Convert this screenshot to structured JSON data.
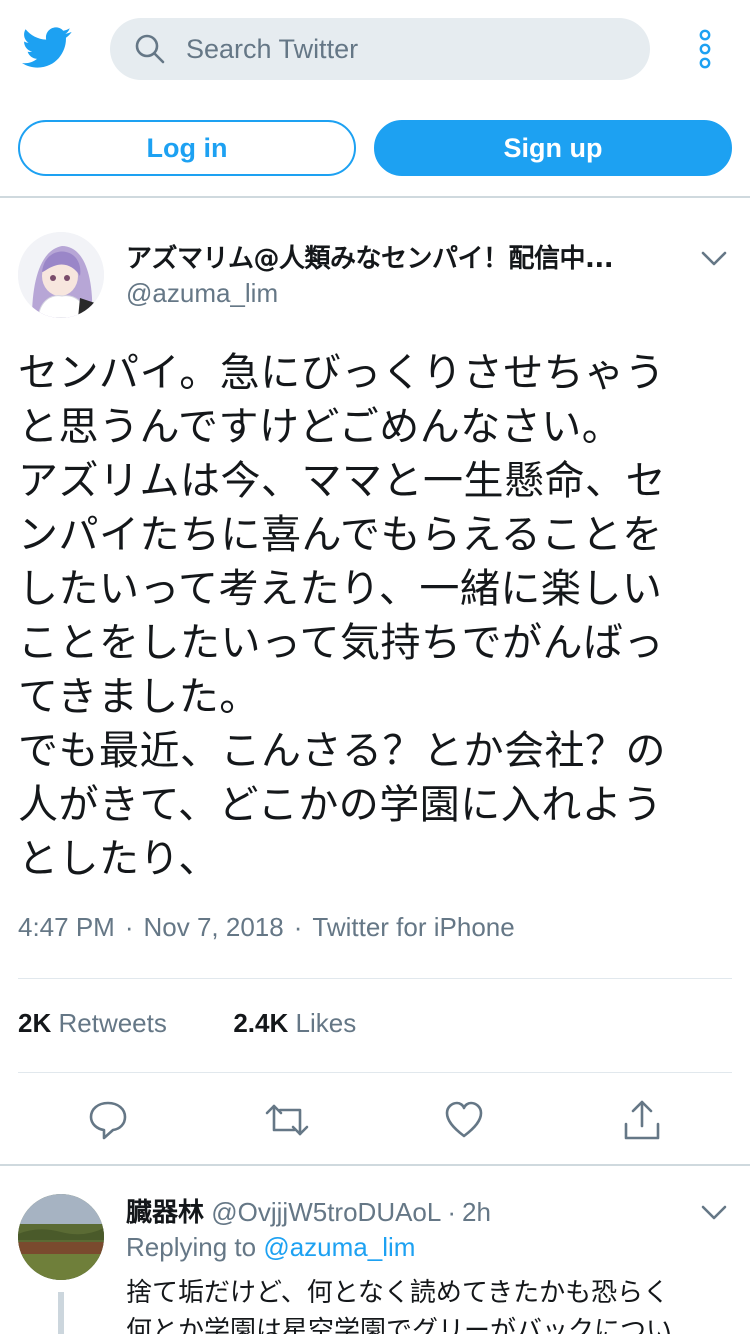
{
  "header": {
    "search_placeholder": "Search Twitter",
    "login_label": "Log in",
    "signup_label": "Sign up",
    "icons": [
      "twitter-bird-icon",
      "search-icon",
      "more-vertical-icon"
    ],
    "accent_color": "#1da1f2"
  },
  "tweet": {
    "display_name": "アズマリム@人類みなセンパイ！配信中...",
    "handle": "@azuma_lim",
    "text": "センパイ。急にびっくりさせちゃう\nと思うんですけどごめんなさい。\nアズリムは今、ママと一生懸命、セ\nンパイたちに喜んでもらえることを\nしたいって考えたり、一緒に楽しい\nことをしたいって気持ちでがんばっ\nてきました。\nでも最近、こんさる？とか会社？の\n人がきて、どこかの学園に入れよう\nとしたり、",
    "time": "4:47 PM",
    "date": "Nov 7, 2018",
    "source": "Twitter for iPhone",
    "retweets_count": "2K",
    "retweets_label": "Retweets",
    "likes_count": "2.4K",
    "likes_label": "Likes"
  },
  "reply": {
    "display_name": "臓器林",
    "handle": "@OvjjjW5troDUAoL",
    "time": "2h",
    "replying_prefix": "Replying to",
    "replying_to": "@azuma_lim",
    "text_line1": "捨て垢だけど、何となく読めてきたかも恐らく",
    "text_line2": "何とか学園は星空学園でグリーがバックについ"
  },
  "separator": "·"
}
